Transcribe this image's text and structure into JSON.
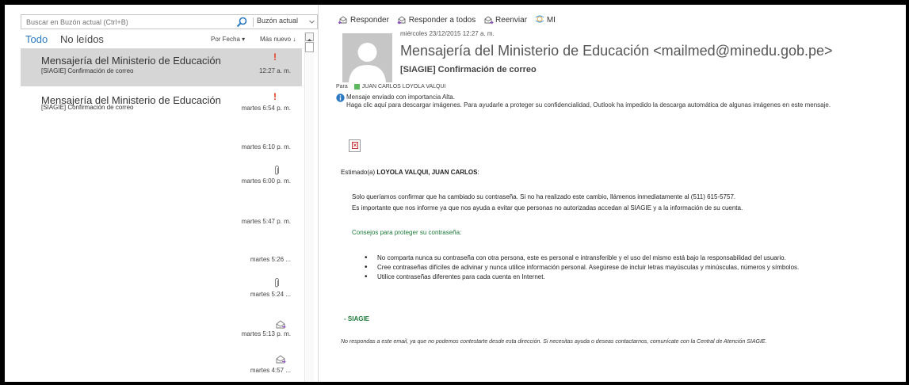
{
  "search": {
    "placeholder": "Buscar en Buzón actual (Ctrl+B)",
    "scope": "Buzón actual"
  },
  "filters": {
    "all": "Todo",
    "unread": "No leídos",
    "sort_field": "Por Fecha",
    "sort_order": "Más nuevo ↓"
  },
  "messages": [
    {
      "sender": "Mensajería del Ministerio de Educación",
      "subject": "[SIAGIE] Confirmación de correo",
      "time": "12:27 a. m.",
      "importance": "!",
      "selected": true
    },
    {
      "sender": "Mensajería del Ministerio de Educación",
      "subject": "[SIAGIE] Confirmación de correo",
      "time": "martes 6:54 p. m.",
      "importance": "!"
    },
    {
      "time": "martes 6:10 p. m."
    },
    {
      "time": "martes 6:00 p. m.",
      "icon": "paperclip-icon"
    },
    {
      "time": "martes 5:47 p. m."
    },
    {
      "time": "martes 5:26 ..."
    },
    {
      "time": "martes 5:24 ...",
      "icon": "paperclip-icon"
    },
    {
      "time": "martes 5:13 p. m.",
      "icon": "envelope-icon"
    },
    {
      "time": "martes 4:57 ...",
      "icon": "envelope-icon"
    }
  ],
  "toolbar": {
    "reply": "Responder",
    "reply_all": "Responder a todos",
    "forward": "Reenviar",
    "im": "MI"
  },
  "email": {
    "date": "miércoles 23/12/2015 12:27 a. m.",
    "from": "Mensajería del Ministerio de Educación <mailmed@minedu.gob.pe>",
    "subject": "[SIAGIE] Confirmación de correo",
    "to_label": "Para",
    "to": "JUAN CARLOS LOYOLA VALQUI",
    "info_line1": "Mensaje enviado con importancia Alta.",
    "info_line2": "Haga clic aquí para descargar imágenes. Para ayudarle a proteger su confidencialidad, Outlook ha impedido la descarga automática de algunas imágenes en este mensaje.",
    "greeting_prefix": "Estimado(a) ",
    "greeting_name": "LOYOLA VALQUI, JUAN CARLOS",
    "greeting_suffix": ":",
    "paragraph1": "Solo queríamos confirmar que ha cambiado su contraseña. Si no ha realizado este cambio, llámenos inmediatamente al (511) 615-5757.",
    "paragraph2": "Es importante que nos informe ya que nos ayuda a evitar que personas no autorizadas accedan al SIAGIE y a la información de su cuenta.",
    "tips_title": "Consejos para proteger su contraseña:",
    "tips": [
      "No comparta nunca su contraseña con otra persona, este es personal e intransferible y el uso del mismo está bajo la responsabilidad del usuario.",
      "Cree contraseñas difíciles de adivinar y nunca utilice información personal. Asegúrese de incluir letras mayúsculas y minúsculas, números y símbolos.",
      "Utilice contraseñas diferentes para cada cuenta en Internet."
    ],
    "signature": "- SIAGIE",
    "footer": "No respondas a este email, ya que no podemos contestarte desde esta dirección. Si necesitas ayuda o deseas contactarnos, comunícate con la Central de Atención SIAGIE."
  },
  "colors": {
    "accent": "#2b79c2",
    "importance": "#e03c1e",
    "green_text": "#1e7a3a",
    "presence": "#5cb85c",
    "selected_row": "#d6d6d6"
  }
}
